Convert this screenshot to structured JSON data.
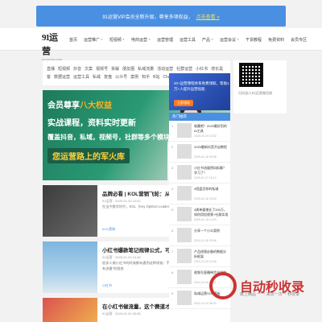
{
  "notice": {
    "text": "91运营VIP会员全新升级，尊享多项权益，",
    "link": "点击查看 »"
  },
  "header": {
    "logo_main": "91",
    "logo_sub": "运营",
    "logo_caption": "91YUNYING.COM",
    "nav": [
      {
        "label": "首页"
      },
      {
        "label": "运营推广",
        "dropdown": true
      },
      {
        "label": "短视频",
        "dropdown": true
      },
      {
        "label": "电商运营",
        "dropdown": true
      },
      {
        "label": "运营管理"
      },
      {
        "label": "运营工具"
      },
      {
        "label": "产品",
        "dropdown": true
      },
      {
        "label": "运营会议",
        "dropdown": true
      },
      {
        "label": "干货教程"
      },
      {
        "label": "免费资料"
      },
      {
        "label": "会员专区"
      }
    ]
  },
  "tags": [
    "直播",
    "短视频",
    "抖音",
    "文案",
    "视频号",
    "拆解",
    "朋友圈",
    "私域流量",
    "活动运营",
    "社群运营",
    "小红书",
    "增长黑客",
    "数据运营",
    "运营工具",
    "私域",
    "复盘",
    "公众号",
    "案例",
    "知乎",
    "B站",
    "ChatGPT"
  ],
  "banner": {
    "line1_a": "会员尊享",
    "line1_b": "八大权益",
    "line2": "实战课程，资料实时更新",
    "line3": "覆盖抖音，私域，视频号，社群等多个模块",
    "line4": "您运营路上的军火库"
  },
  "articles": [
    {
      "title": "品牌必看 | KOL营销飞轮：从认知到成交",
      "meta": "91运营 · 2025-01-20 13:02",
      "desc": "在当今数字时代，KOL（Key Opinion Leader，关键意见领袖）营销作为一种",
      "tag": "KOL营销"
    },
    {
      "title": "小红书爆款笔记规律公式，可直接套用！！",
      "meta": "91运营 · 2025-01-20 10:48",
      "desc": "很多人做小红书的时候都有遇到这种烦恼：不少人都有“我已经写好了笔记，就是没有流量”的困惑",
      "tag": "小红书"
    },
    {
      "title": "在小红书催流量，这个赛道才是黑马！",
      "meta": "91运营 · 2025-01-20 09:55",
      "desc": "",
      "tag": ""
    }
  ],
  "ad": {
    "text": "20+运营课程体系免费领取，帮助1万+人提升运营技能",
    "button": "立即领取"
  },
  "qr": {
    "caption": "扫码加入91运营微信群"
  },
  "hot": {
    "heading": "热门推荐",
    "items": [
      {
        "num": "1",
        "text": "收藏吧！2025最好用的AI工具",
        "date": "2025-01-19 10:32"
      },
      {
        "num": "2",
        "text": "2025最新抖音开店教程",
        "date": "2025-01-18 09:08"
      },
      {
        "num": "3",
        "text": "小红书流量密码拆解？学习了！",
        "date": "2025-01-17 15:12"
      },
      {
        "num": "4",
        "text": "3招盘活你的私域",
        "date": "2025-01-16 18:40"
      },
      {
        "num": "5",
        "text": "3周单量增长了200万，如何用短视频+社群实现",
        "date": "2025-01-15 14:23"
      },
      {
        "num": "6",
        "text": "分享一个小众案例",
        "date": "2024-12-28 20:06"
      },
      {
        "num": "7",
        "text": "产品经理必备的数据分析框架",
        "date": "2024-12-20 12:45"
      },
      {
        "num": "8",
        "text": "视频号直播带货全攻略",
        "date": "2024-12-15 16:11"
      },
      {
        "num": "9",
        "text": "私域运营SOP模板",
        "date": "2024-12-10 08:30"
      }
    ]
  },
  "watermark": {
    "text": "自动秒收录",
    "sub": "做上精品 一一 来访一次一 秒收录"
  }
}
